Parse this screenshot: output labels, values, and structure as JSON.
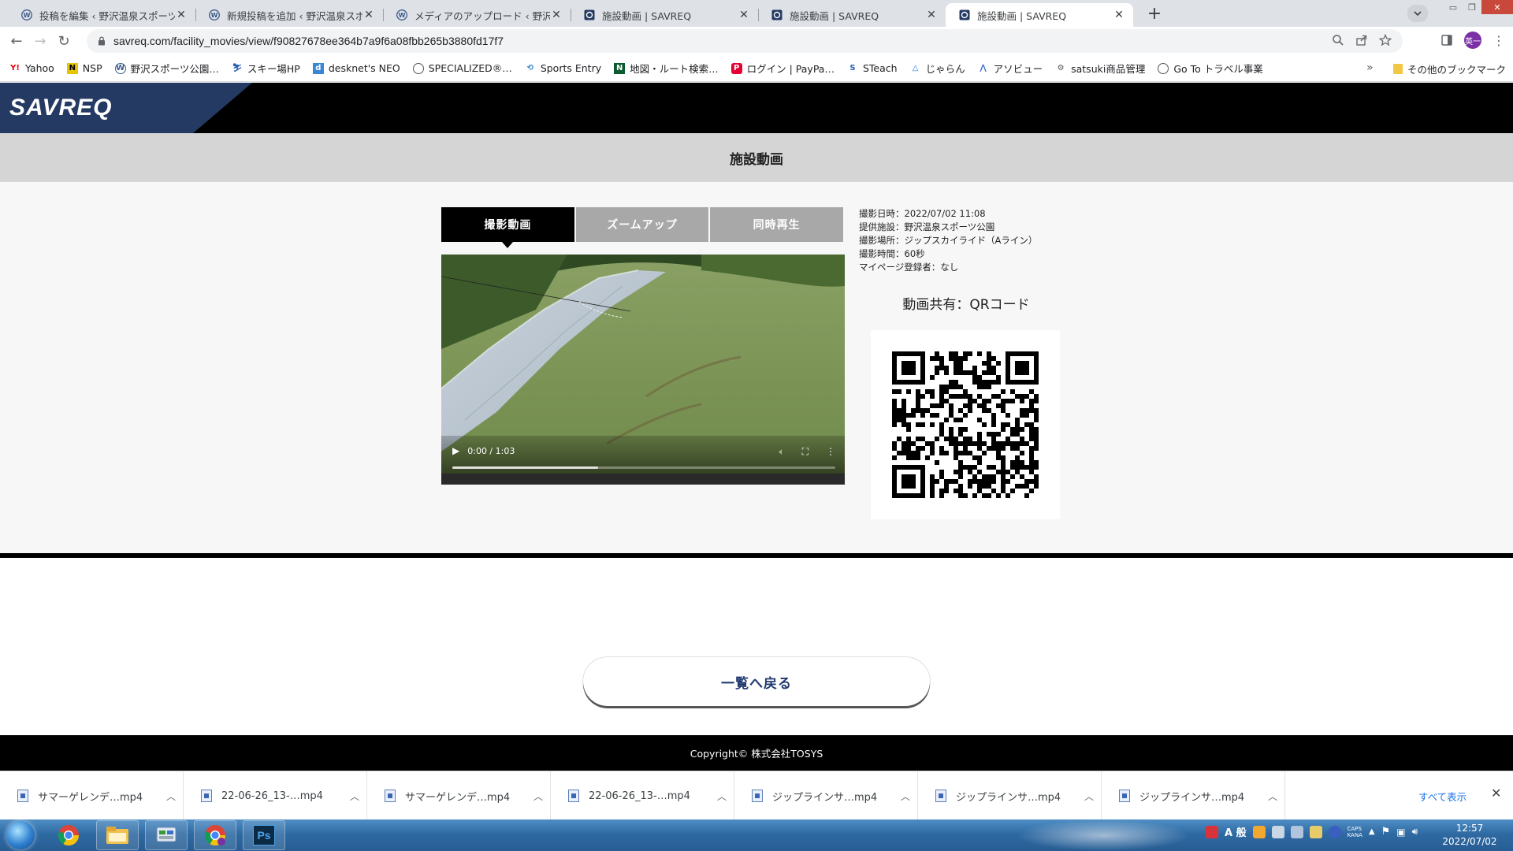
{
  "browser": {
    "tabs": [
      {
        "title": "投稿を編集 ‹ 野沢温泉スポーツ公園",
        "icon": "wordpress-icon"
      },
      {
        "title": "新規投稿を追加 ‹ 野沢温泉スポーツ公園",
        "icon": "wordpress-icon"
      },
      {
        "title": "メディアのアップロード ‹ 野沢温泉",
        "icon": "wordpress-icon"
      },
      {
        "title": "施設動画 | SAVREQ",
        "icon": "savreq-icon"
      },
      {
        "title": "施設動画 | SAVREQ",
        "icon": "savreq-icon"
      },
      {
        "title": "施設動画 | SAVREQ",
        "icon": "savreq-icon"
      }
    ],
    "active_tab": 5,
    "url": "savreq.com/facility_movies/view/f90827678ee364b7a9f6a08fbb265b3880fd17f7",
    "profile_initial": "英一",
    "bookmarks": [
      {
        "label": "Yahoo",
        "icon": "yahoo-icon"
      },
      {
        "label": "NSP",
        "icon": "nsp-icon"
      },
      {
        "label": "野沢スポーツ公園…",
        "icon": "wordpress-icon"
      },
      {
        "label": "スキー場HP",
        "icon": "ski-icon"
      },
      {
        "label": "desknet's NEO",
        "icon": "desknets-icon"
      },
      {
        "label": "SPECIALIZED®…",
        "icon": "globe-icon"
      },
      {
        "label": "Sports Entry",
        "icon": "sports-entry-icon"
      },
      {
        "label": "地図・ルート検索…",
        "icon": "navitime-icon"
      },
      {
        "label": "ログイン | PayPa…",
        "icon": "paypay-icon"
      },
      {
        "label": "STeach",
        "icon": "steach-icon"
      },
      {
        "label": "じゃらん",
        "icon": "jalan-icon"
      },
      {
        "label": "アソビュー",
        "icon": "asoview-icon"
      },
      {
        "label": "satsuki商品管理",
        "icon": "satsuki-icon"
      },
      {
        "label": "Go To トラベル事業",
        "icon": "globe-icon"
      }
    ],
    "bookmarks_more": "»",
    "other_bookmarks": "その他のブックマーク"
  },
  "site": {
    "logo": "SAVREQ",
    "page_title": "施設動画",
    "video_tabs": [
      "撮影動画",
      "ズームアップ",
      "同時再生"
    ],
    "active_video_tab": 0,
    "video": {
      "time": "0:00 / 1:03",
      "progress": 0,
      "buffered_fraction": 0.38
    },
    "info": [
      "撮影日時：2022/07/02 11:08",
      "提供施設：野沢温泉スポーツ公園",
      "撮影場所：ジップスカイライド（Aライン）",
      "撮影時間：60秒",
      "マイページ登録者：なし"
    ],
    "qr_label": "動画共有：QRコード",
    "back_button": "一覧へ戻る",
    "copyright": "Copyright© 株式会社TOSYS"
  },
  "downloads": {
    "items": [
      "サマーゲレンデ…mp4",
      "22-06-26_13-…mp4",
      "サマーゲレンデ…mp4",
      "22-06-26_13-…mp4",
      "ジップラインサ…mp4",
      "ジップラインサ…mp4",
      "ジップラインサ…mp4"
    ],
    "show_all": "すべて表示"
  },
  "taskbar": {
    "apps": [
      "chrome-icon",
      "explorer-icon",
      "control-panel-icon",
      "chrome-profile-icon",
      "photoshop-icon"
    ],
    "photoshop_label": "Ps",
    "clock_time": "12:57",
    "clock_date": "2022/07/02",
    "ime_label": "A 般"
  }
}
